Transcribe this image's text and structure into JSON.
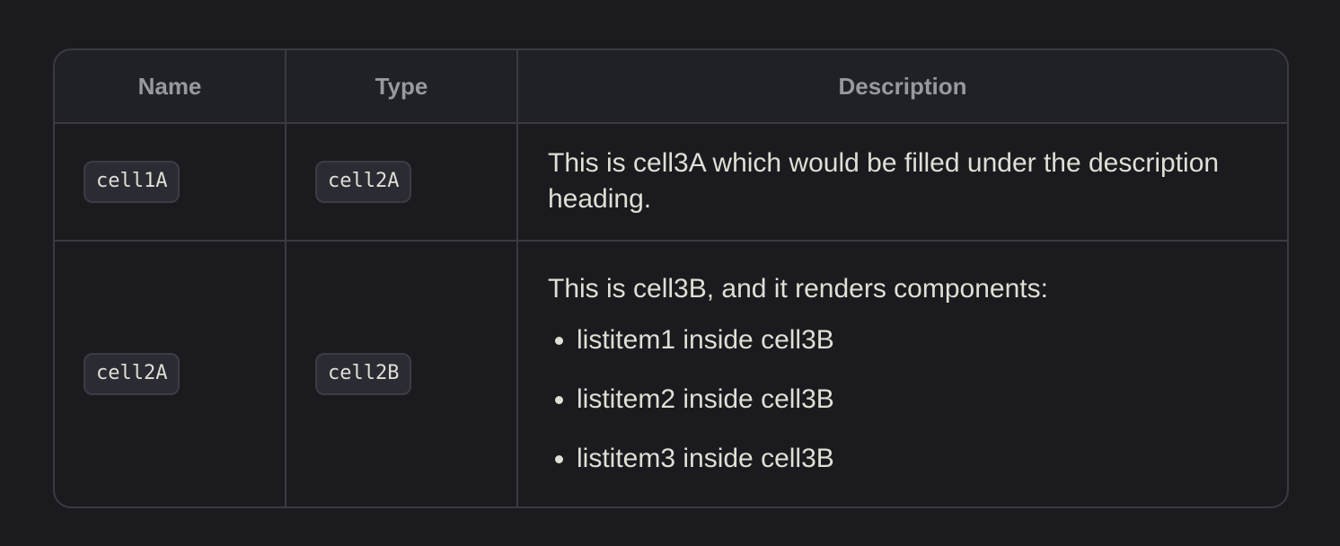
{
  "table": {
    "headers": {
      "name": "Name",
      "type": "Type",
      "description": "Description"
    },
    "rows": [
      {
        "name": "cell1A",
        "type": "cell2A",
        "description": "This is cell3A which would be filled under the description heading."
      },
      {
        "name": "cell2A",
        "type": "cell2B",
        "description": "This is cell3B, and it renders components:",
        "list_items": [
          "listitem1 inside cell3B",
          "listitem2 inside cell3B",
          "listitem3 inside cell3B"
        ]
      }
    ]
  },
  "colors": {
    "background": "#1b1b1f",
    "header_background": "#202127",
    "border": "#3a3a40",
    "header_text": "#98989f",
    "body_text": "#dfdfd6",
    "code_background": "#2b2c33"
  }
}
